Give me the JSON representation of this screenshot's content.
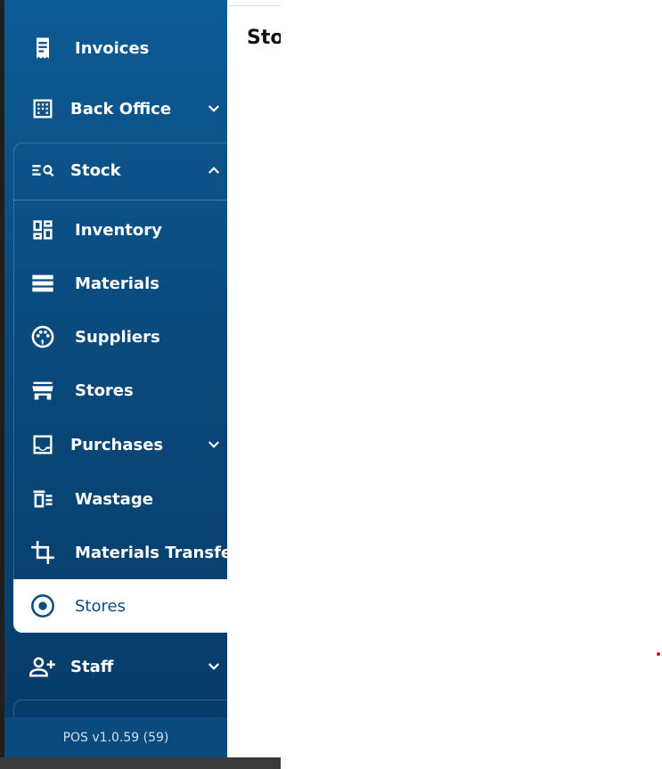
{
  "sidebar": {
    "items": [
      {
        "label": "Invoices",
        "icon": "receipt-icon"
      },
      {
        "label": "Back Office",
        "icon": "building-icon"
      },
      {
        "label": "Stock",
        "icon": "search-list-icon"
      },
      {
        "label": "Inventory",
        "icon": "dashboard-icon"
      },
      {
        "label": "Materials",
        "icon": "storage-icon"
      },
      {
        "label": "Suppliers",
        "icon": "palette-icon"
      },
      {
        "label": "Stores",
        "icon": "storefront-icon"
      },
      {
        "label": "Purchases",
        "icon": "inbox-icon"
      },
      {
        "label": "Wastage",
        "icon": "wastage-icon"
      },
      {
        "label": "Materials Transfer",
        "icon": "crop-icon"
      },
      {
        "label": "Stores",
        "icon": "radio-button-icon"
      },
      {
        "label": "Staff",
        "icon": "add-person-icon"
      }
    ],
    "version": "POS v1.0.59 (59)"
  },
  "main": {
    "title": "Sto"
  },
  "colors": {
    "sidebar": "#0b4e86",
    "active_bg": "#ffffff",
    "accent_dot": "#d01010"
  }
}
